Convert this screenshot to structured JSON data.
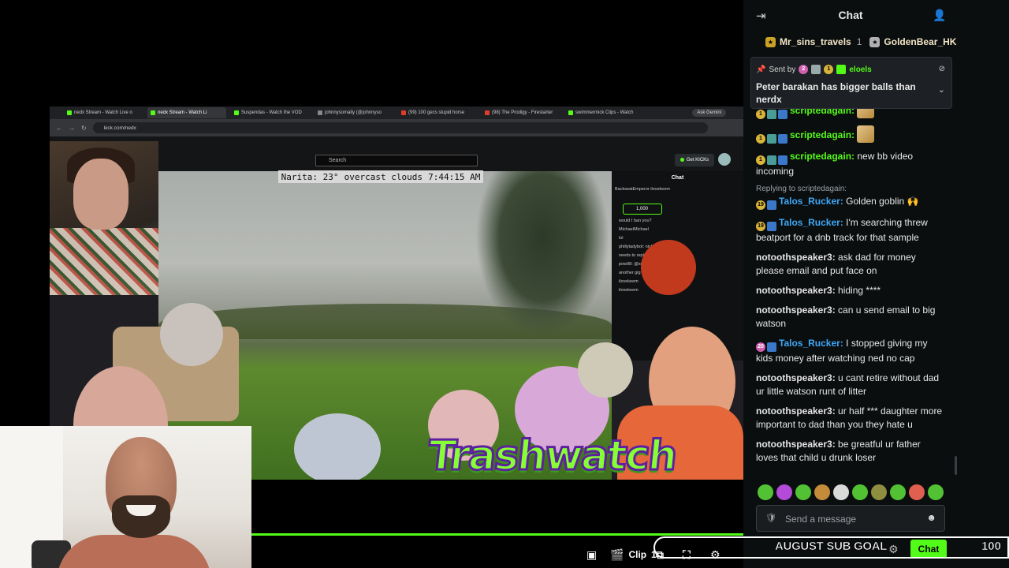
{
  "browser": {
    "tabs": [
      {
        "label": "nedx Stream - Watch Live o",
        "fav": "green"
      },
      {
        "label": "nedx Stream - Watch Li",
        "fav": "green"
      },
      {
        "label": "Suspendas - Watch the VOD",
        "fav": "green"
      },
      {
        "label": "johnnysomally (@johnnyso",
        "fav": "gray"
      },
      {
        "label": "(99) 100 gecs stupid horse",
        "fav": "red"
      },
      {
        "label": "(98) The Prodigy - Firestarter",
        "fav": "red"
      },
      {
        "label": "swimmermick Clips - Watch",
        "fav": "green"
      }
    ],
    "gemini_label": "Ask Gemini",
    "url": "kick.com/nedx"
  },
  "kick_page": {
    "search_placeholder": "Search",
    "get_kicks_label": "Get KICKs",
    "inner_chat": {
      "header": "Chat",
      "pinned_users": "BackseatEmperor  ilovekeem",
      "kicks_value": "1,000",
      "lines": [
        "would I ban you?",
        "MichaelMichael",
        "lol",
        "phillytadybot: nick so bc",
        "needs to replay same audio 10",
        "pow98: @scripter",
        "another gig as a",
        "ilovekeem",
        "ilovekeem"
      ]
    }
  },
  "overlay": {
    "weather": {
      "location": "Narita: 23°",
      "conditions": "overcast clouds",
      "time": "7:44:15 AM"
    },
    "banner": "Trashwatch"
  },
  "player": {
    "progress": 1.0,
    "clip_label": "Clip",
    "clip_count": "1"
  },
  "chat": {
    "title": "Chat",
    "gifters": [
      {
        "name": "Mr_sins_travels",
        "count": "1",
        "tier": "gold"
      },
      {
        "name": "GoldenBear_HK",
        "count": "",
        "tier": "silver"
      }
    ],
    "pinned": {
      "sent_by_label": "Sent by",
      "sender": "eloels",
      "message": "Peter barakan has bigger balls than nerdx"
    },
    "messages": [
      {
        "user": "scriptedagain",
        "color": "#53fc18",
        "badges": [
          "gold",
          "teal",
          "blue"
        ],
        "text": "",
        "emote": true
      },
      {
        "user": "scriptedagain",
        "color": "#53fc18",
        "badges": [
          "gold",
          "teal",
          "blue"
        ],
        "text": "",
        "emote": true
      },
      {
        "user": "scriptedagain",
        "color": "#53fc18",
        "badges": [
          "gold",
          "teal",
          "blue"
        ],
        "text": "new bb video incoming"
      },
      {
        "reply": "Replying to scriptedagain:",
        "user": "Talos_Rucker",
        "color": "#3fa7f5",
        "badges": [
          "gold",
          "blue"
        ],
        "badge_num": "19",
        "text": "Golden goblin 🙌"
      },
      {
        "user": "Talos_Rucker",
        "color": "#3fa7f5",
        "badges": [
          "gold",
          "blue"
        ],
        "badge_num": "19",
        "text": "I'm searching threw beatport for a dnb track for that sample"
      },
      {
        "user": "notoothspeaker3",
        "color": "#e6e6e6",
        "badges": [],
        "text": "ask dad for money please email and put face on"
      },
      {
        "user": "notoothspeaker3",
        "color": "#e6e6e6",
        "badges": [],
        "text": "hiding ****"
      },
      {
        "user": "notoothspeaker3",
        "color": "#e6e6e6",
        "badges": [],
        "text": "can u send email to big watson"
      },
      {
        "user": "Talos_Rucker",
        "color": "#3fa7f5",
        "badges": [
          "pink",
          "blue"
        ],
        "badge_num": "20",
        "text": "I stopped giving my kids money after watching ned no cap"
      },
      {
        "user": "notoothspeaker3",
        "color": "#e6e6e6",
        "badges": [],
        "text": "u cant retire without dad ur little watson runt of litter"
      },
      {
        "user": "notoothspeaker3",
        "color": "#e6e6e6",
        "badges": [],
        "text": "ur half *** daughter more important to dad than you they hate u"
      },
      {
        "user": "notoothspeaker3",
        "color": "#e6e6e6",
        "badges": [],
        "text": "be greatful ur father loves that child u drunk loser"
      }
    ],
    "input_placeholder": "Send a message",
    "chat_button": "Chat"
  },
  "sub_goal": {
    "label": "AUGUST SUB GOAL",
    "value": "100"
  }
}
